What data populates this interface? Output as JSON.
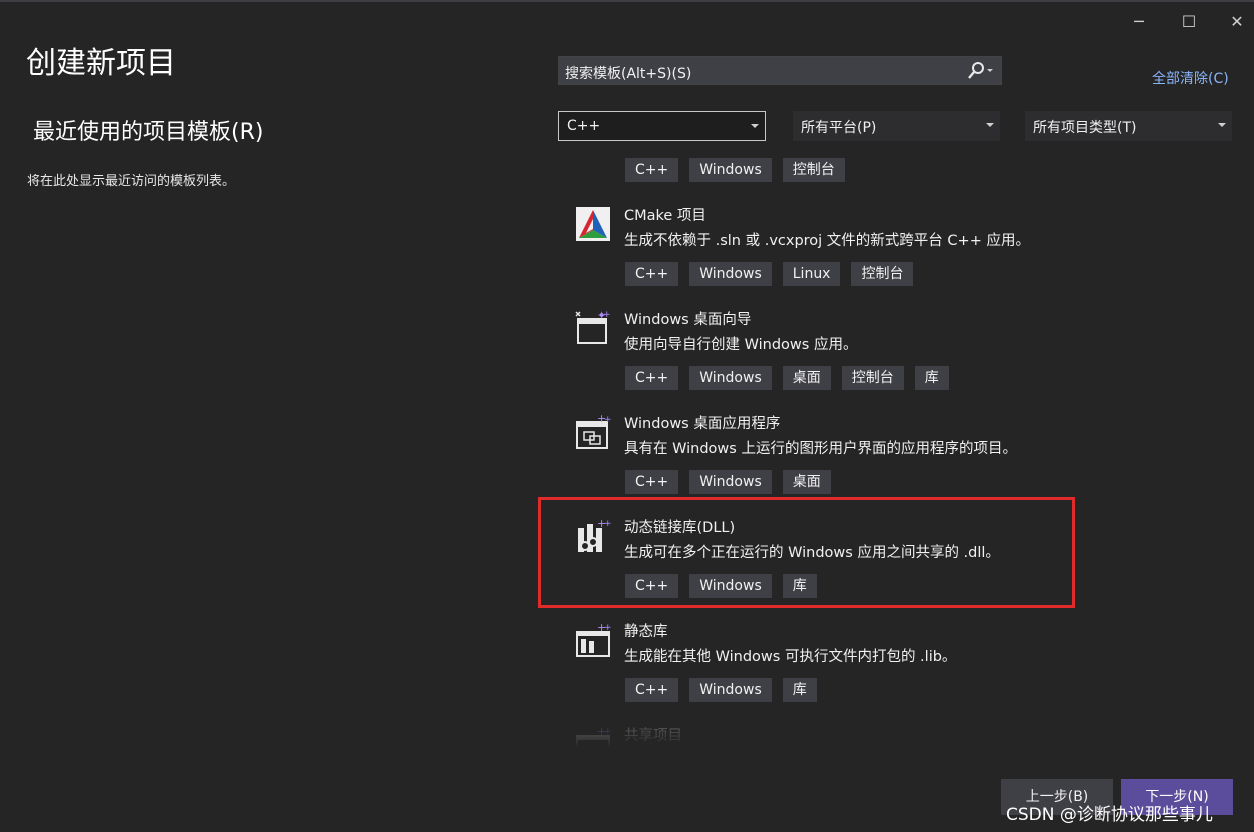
{
  "window": {
    "minimize_glyph": "─",
    "maximize_glyph": "☐",
    "close_glyph": "✕"
  },
  "page_title": "创建新项目",
  "recent": {
    "title": "最近使用的项目模板(R)",
    "empty_text": "将在此处显示最近访问的模板列表。"
  },
  "search": {
    "placeholder": "搜索模板(Alt+S)(S)",
    "clear_all": "全部清除(C)"
  },
  "filters": {
    "language": "C++",
    "platform": "所有平台(P)",
    "project_type": "所有项目类型(T)"
  },
  "templates": [
    {
      "name": "",
      "description": "",
      "tags": [
        "C++",
        "Windows",
        "控制台"
      ],
      "icon": "console-app-icon"
    },
    {
      "name": "CMake 项目",
      "description": "生成不依赖于 .sln 或 .vcxproj 文件的新式跨平台 C++ 应用。",
      "tags": [
        "C++",
        "Windows",
        "Linux",
        "控制台"
      ],
      "icon": "cmake-icon"
    },
    {
      "name": "Windows 桌面向导",
      "description": "使用向导自行创建 Windows 应用。",
      "tags": [
        "C++",
        "Windows",
        "桌面",
        "控制台",
        "库"
      ],
      "icon": "wizard-icon"
    },
    {
      "name": "Windows 桌面应用程序",
      "description": "具有在 Windows 上运行的图形用户界面的应用程序的项目。",
      "tags": [
        "C++",
        "Windows",
        "桌面"
      ],
      "icon": "desktop-app-icon"
    },
    {
      "name": "动态链接库(DLL)",
      "description": "生成可在多个正在运行的 Windows 应用之间共享的 .dll。",
      "tags": [
        "C++",
        "Windows",
        "库"
      ],
      "icon": "dll-icon"
    },
    {
      "name": "静态库",
      "description": "生成能在其他 Windows 可执行文件内打包的 .lib。",
      "tags": [
        "C++",
        "Windows",
        "库"
      ],
      "icon": "static-lib-icon"
    },
    {
      "name": "共享项目",
      "description": "",
      "tags": [],
      "icon": "shared-project-icon"
    }
  ],
  "buttons": {
    "back": "上一步(B)",
    "next": "下一步(N)"
  },
  "watermark": "CSDN @诊断协议那些事儿",
  "colors": {
    "background": "#252526",
    "accent": "#5b4d9b",
    "highlight": "#e02b2b",
    "link": "#8ab4f8"
  }
}
